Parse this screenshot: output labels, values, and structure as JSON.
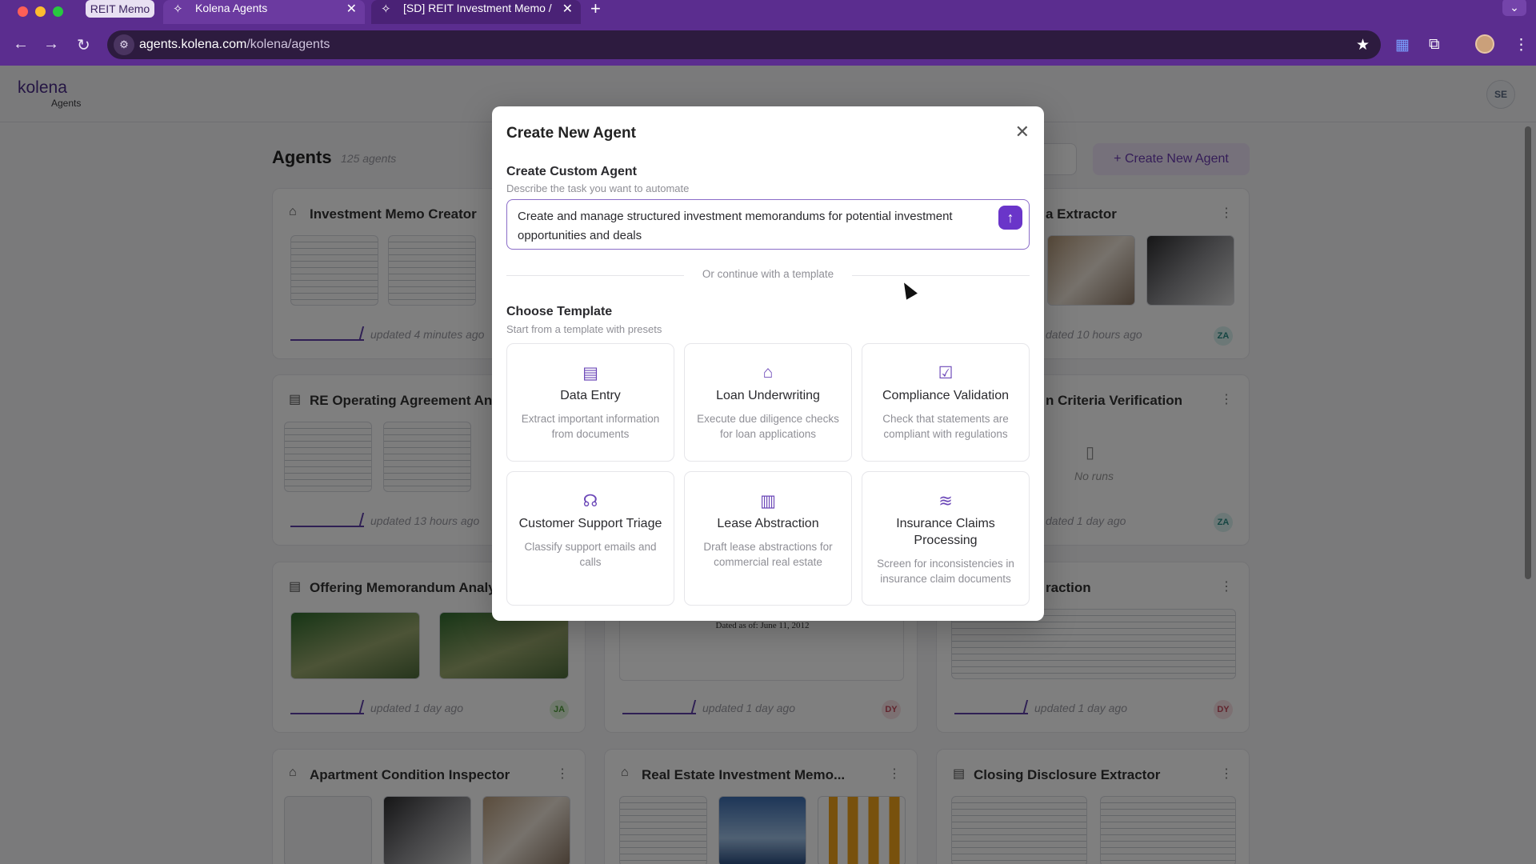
{
  "browser": {
    "group_label": "REIT Memo",
    "tabs": [
      {
        "title": "Kolena Agents",
        "icon": "kolena-icon"
      },
      {
        "title": "[SD] REIT Investment Memo /",
        "icon": "kolena-icon"
      }
    ],
    "url_host": "agents.kolena.com",
    "url_path": "/kolena/agents"
  },
  "app": {
    "logo_text": "kolena",
    "logo_sub": "Agents",
    "user_initials": "SE"
  },
  "page": {
    "title": "Agents",
    "count": "125 agents",
    "create_button": "+ Create New Agent"
  },
  "cards": [
    {
      "title": "Investment Memo Creator",
      "updated": "updated 4 minutes ago",
      "badge": ""
    },
    {
      "title": "a Extractor",
      "updated": "dated 10 hours ago",
      "badge": "ZA"
    },
    {
      "title": "RE Operating Agreement Ana",
      "updated": "updated 13 hours ago",
      "badge": ""
    },
    {
      "title": "n Criteria Verification",
      "updated": "dated 1 day ago",
      "badge": "ZA",
      "no_runs": "No runs"
    },
    {
      "title": "Offering Memorandum Analy",
      "updated": "updated 1 day ago",
      "badge": "JA"
    },
    {
      "title": "",
      "updated": "updated 1 day ago",
      "badge": "DY",
      "doc_text": "Dated as of: June 11, 2012"
    },
    {
      "title": "raction",
      "updated": "updated 1 day ago",
      "badge": "DY"
    },
    {
      "title": "Apartment Condition Inspector",
      "updated": "",
      "badge": ""
    },
    {
      "title": "Real Estate Investment Memo...",
      "updated": "",
      "badge": ""
    },
    {
      "title": "Closing Disclosure Extractor",
      "updated": "",
      "badge": ""
    }
  ],
  "modal": {
    "title": "Create New Agent",
    "custom_title": "Create Custom Agent",
    "custom_sub": "Describe the task you want to automate",
    "prompt_text": "Create and manage structured investment memorandums for potential investment opportunities and deals",
    "divider_text": "Or continue with a template",
    "template_title": "Choose Template",
    "template_sub": "Start from a template with presets",
    "templates": [
      {
        "name": "Data Entry",
        "desc": "Extract important information from documents",
        "icon": "document-icon"
      },
      {
        "name": "Loan Underwriting",
        "desc": "Execute due diligence checks for loan applications",
        "icon": "bank-icon"
      },
      {
        "name": "Compliance Validation",
        "desc": "Check that statements are compliant with regulations",
        "icon": "checklist-icon"
      },
      {
        "name": "Customer Support Triage",
        "desc": "Classify support emails and calls",
        "icon": "headset-icon"
      },
      {
        "name": "Lease Abstraction",
        "desc": "Draft lease abstractions for commercial real estate",
        "icon": "building-icon"
      },
      {
        "name": "Insurance Claims Processing",
        "desc": "Screen for inconsistencies in insurance claim documents",
        "icon": "speed-icon"
      }
    ]
  }
}
